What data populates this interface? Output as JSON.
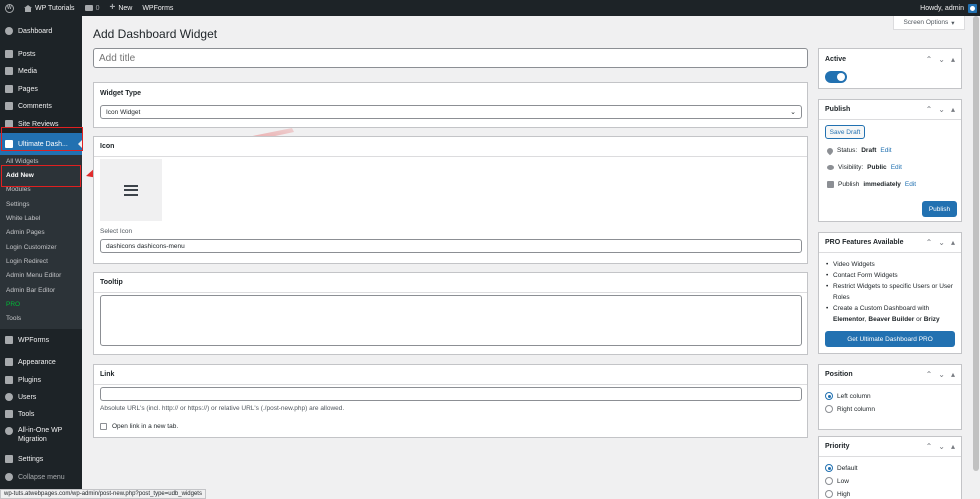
{
  "adminbar": {
    "site_name": "WP Tutorials",
    "comments_count": "0",
    "new_label": "New",
    "wpforms_label": "WPForms",
    "howdy": "Howdy, admin"
  },
  "sidebar": {
    "dashboard": "Dashboard",
    "posts": "Posts",
    "media": "Media",
    "pages": "Pages",
    "comments": "Comments",
    "site_reviews": "Site Reviews",
    "ultimate_dash": "Ultimate Dash...",
    "submenu": [
      "All Widgets",
      "Add New",
      "Modules",
      "Settings",
      "White Label",
      "Admin Pages",
      "Login Customizer",
      "Login Redirect",
      "Admin Menu Editor",
      "Admin Bar Editor",
      "PRO",
      "Tools"
    ],
    "wpforms": "WPForms",
    "appearance": "Appearance",
    "plugins": "Plugins",
    "users": "Users",
    "tools": "Tools",
    "all_in_one_1": "All-in-One WP",
    "all_in_one_2": "Migration",
    "settings": "Settings",
    "collapse": "Collapse menu"
  },
  "screen_options": "Screen Options",
  "page_title": "Add Dashboard Widget",
  "title_placeholder": "Add title",
  "widget_type": {
    "heading": "Widget Type",
    "selected": "Icon Widget"
  },
  "icon_box": {
    "heading": "Icon",
    "select_label": "Select Icon",
    "value": "dashicons dashicons-menu"
  },
  "tooltip_box": {
    "heading": "Tooltip"
  },
  "link_box": {
    "heading": "Link",
    "help": "Absolute URL's (incl. http:// or https://) or relative URL's (./post-new.php) are allowed.",
    "new_tab_label": "Open link in a new tab."
  },
  "active_box": {
    "heading": "Active"
  },
  "publish_box": {
    "heading": "Publish",
    "save_draft": "Save Draft",
    "status_label": "Status:",
    "status_value": "Draft",
    "visibility_label": "Visibility:",
    "visibility_value": "Public",
    "publish_label": "Publish",
    "publish_value": "immediately",
    "edit": "Edit",
    "publish_button": "Publish"
  },
  "pro_box": {
    "heading": "PRO Features Available",
    "features": [
      "Video Widgets",
      "Contact Form Widgets",
      "Restrict Widgets to specific Users or User",
      "Roles",
      "Create a Custom Dashboard with"
    ],
    "builders_1": "Elementor",
    "builders_sep1": ", ",
    "builders_2": "Beaver Builder",
    "builders_sep2": " or ",
    "builders_3": "Brizy",
    "cta": "Get Ultimate Dashboard PRO"
  },
  "position_box": {
    "heading": "Position",
    "options": [
      "Left column",
      "Right column"
    ]
  },
  "priority_box": {
    "heading": "Priority",
    "options": [
      "Default",
      "Low",
      "High"
    ]
  },
  "status_bar_url": "wp-tuts.atwebpages.com/wp-admin/post-new.php?post_type=udb_widgets",
  "colors": {
    "accent": "#2271b1",
    "sidebar_bg": "#1d2327",
    "highlight_red": "#e02020"
  }
}
